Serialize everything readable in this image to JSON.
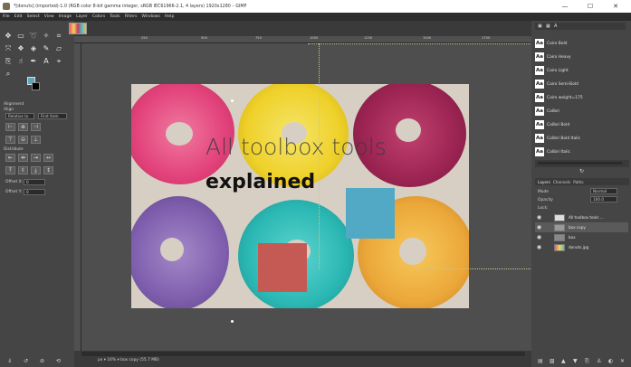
{
  "window": {
    "title": "*[donuts] (imported)-1.0 (RGB color 8-bit gamma integer, sRGB IEC61966-2.1, 4 layers) 1920x1280 – GIMP",
    "minimize": "—",
    "maximize": "☐",
    "close": "✕"
  },
  "menu": [
    "File",
    "Edit",
    "Select",
    "View",
    "Image",
    "Layer",
    "Colors",
    "Tools",
    "Filters",
    "Windows",
    "Help"
  ],
  "colors": {
    "foreground": "#5aa7c0",
    "background": "#000000",
    "canvas_bg": "#4e4e4e",
    "accent_blue_box": "#52a9c5",
    "accent_red_box": "#c55a55"
  },
  "toolbox": {
    "tools": [
      "move-tool",
      "rect-select-tool",
      "lasso-tool",
      "fuzzy-select-tool",
      "crop-tool",
      "unified-transform-tool",
      "warp-tool",
      "bucket-fill-tool",
      "paintbrush-tool",
      "eraser-tool",
      "clone-tool",
      "smudge-tool",
      "path-tool",
      "text-tool",
      "color-picker-tool",
      "zoom-tool"
    ],
    "options": {
      "section": "Alignment",
      "align_label": "Align",
      "relative_to_label": "Relative to",
      "relative_to_value": "First item",
      "distribute_label": "Distribute",
      "offset_x_label": "Offset X:",
      "offset_x_value": "0",
      "offset_y_label": "Offset Y:",
      "offset_y_value": "0"
    }
  },
  "ruler": {
    "ticks": [
      "250",
      "500",
      "750",
      "1000",
      "1250",
      "1500",
      "1750"
    ]
  },
  "canvas": {
    "text_line_1": "All toolbox tools",
    "text_line_2": "explained"
  },
  "status": {
    "unit": "px",
    "zoom": "16%",
    "layer_info": "box copy (55.7 MB)"
  },
  "fonts_panel": {
    "items": [
      "Cairo Bold",
      "Cairo Heavy",
      "Cairo Light",
      "Cairo Semi-Bold",
      "Cairo weight=175",
      "Calibri",
      "Calibri Bold",
      "Calibri Bold Italic",
      "Calibri Italic"
    ]
  },
  "layers_panel": {
    "tabs": [
      "Layers",
      "Channels",
      "Paths"
    ],
    "mode_label": "Mode",
    "mode_value": "Normal",
    "opacity_label": "Opacity",
    "opacity_value": "100.0",
    "lock_label": "Lock:",
    "layers": [
      {
        "name": "All toolbox tools ...",
        "type": "text"
      },
      {
        "name": "box copy",
        "type": "image"
      },
      {
        "name": "box",
        "type": "image"
      },
      {
        "name": "donuts.jpg",
        "type": "image"
      }
    ]
  }
}
